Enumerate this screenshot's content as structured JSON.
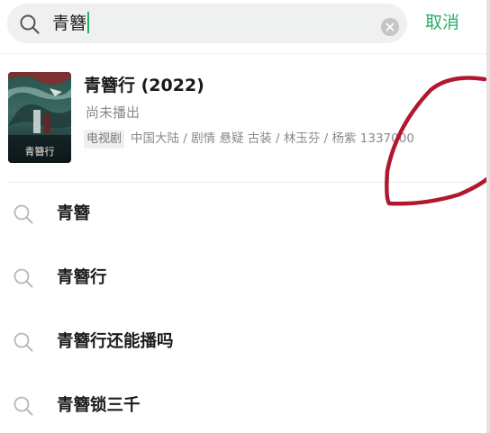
{
  "search": {
    "query": "青簪",
    "cancel_label": "取消"
  },
  "result": {
    "title": "青簪行 (2022)",
    "status": "尚未播出",
    "badge": "电视剧",
    "meta": "中国大陆 / 剧情 悬疑 古装 / 林玉芬 / 杨紫 1337000",
    "poster_caption": "青簪行"
  },
  "suggestions": [
    {
      "text": "青簪"
    },
    {
      "text": "青簪行"
    },
    {
      "text": "青簪行还能播吗"
    },
    {
      "text": "青簪锁三千"
    }
  ],
  "colors": {
    "accent": "#2aae67",
    "annotation": "#b01830",
    "search_bg": "#eef1ef"
  },
  "icons": {
    "search": "search-icon",
    "clear": "clear-icon",
    "suggestion": "search-icon"
  }
}
